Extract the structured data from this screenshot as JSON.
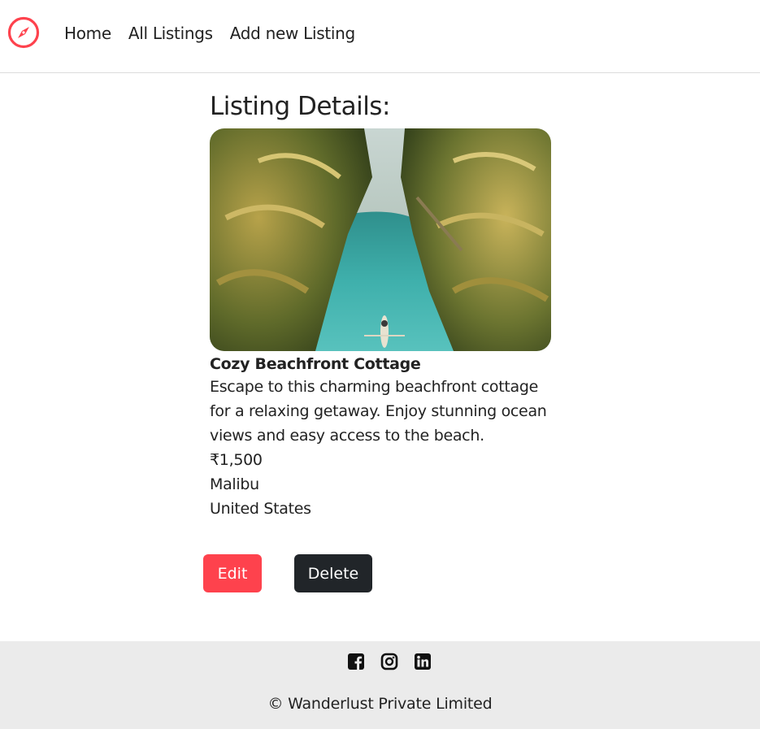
{
  "nav": {
    "brand_icon": "compass-icon",
    "links": [
      {
        "label": "Home"
      },
      {
        "label": "All Listings"
      },
      {
        "label": "Add new Listing"
      }
    ]
  },
  "page": {
    "heading": "Listing Details:"
  },
  "listing": {
    "image_alt": "tropical river with palm trees and boat",
    "title": "Cozy Beachfront Cottage",
    "description": "Escape to this charming beachfront cottage for a relaxing getaway. Enjoy stunning ocean views and easy access to the beach.",
    "price": "₹1,500",
    "location": "Malibu",
    "country": "United States"
  },
  "actions": {
    "edit_label": "Edit",
    "delete_label": "Delete"
  },
  "footer": {
    "social_icons": [
      "facebook-icon",
      "instagram-icon",
      "linkedin-icon"
    ],
    "copyright": "© Wanderlust Private Limited"
  },
  "colors": {
    "accent": "#fe424d",
    "dark_button": "#212529",
    "footer_bg": "#ebebeb"
  }
}
